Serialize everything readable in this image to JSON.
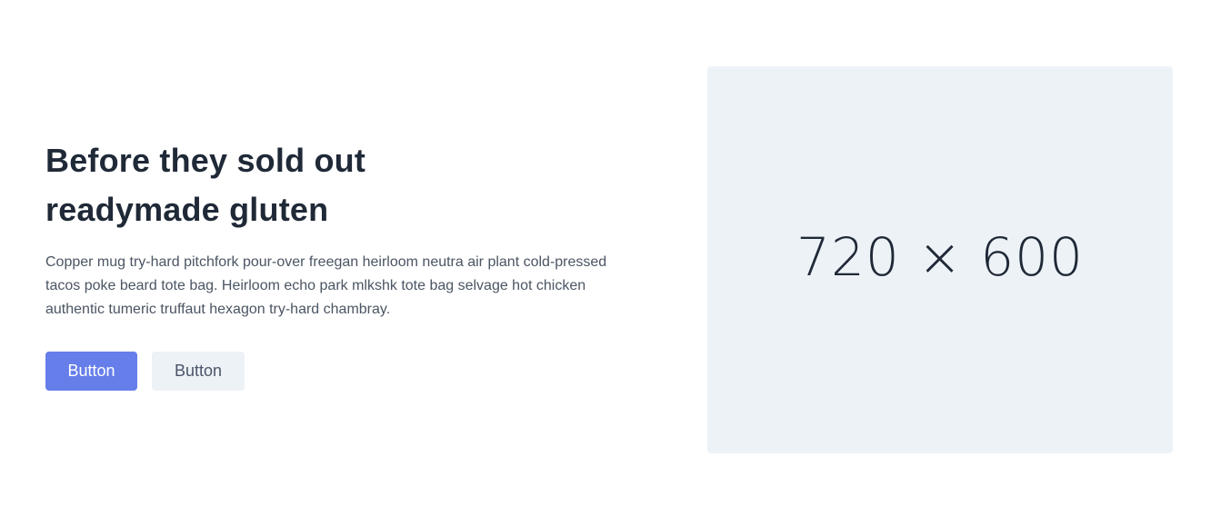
{
  "hero": {
    "title_line_1": "Before they sold out",
    "title_line_2": "readymade gluten",
    "description": "Copper mug try-hard pitchfork pour-over freegan heirloom neutra air plant cold-pressed tacos poke beard tote bag. Heirloom echo park mlkshk tote bag selvage hot chicken authentic tumeric truffaut hexagon try-hard chambray.",
    "buttons": {
      "primary_label": "Button",
      "secondary_label": "Button"
    },
    "image": {
      "placeholder_text": "720 × 600",
      "background_color": "#edf2f7"
    },
    "colors": {
      "primary": "#667eea",
      "secondary": "#edf2f7",
      "heading": "#1f2937",
      "body": "#4b5563"
    }
  }
}
